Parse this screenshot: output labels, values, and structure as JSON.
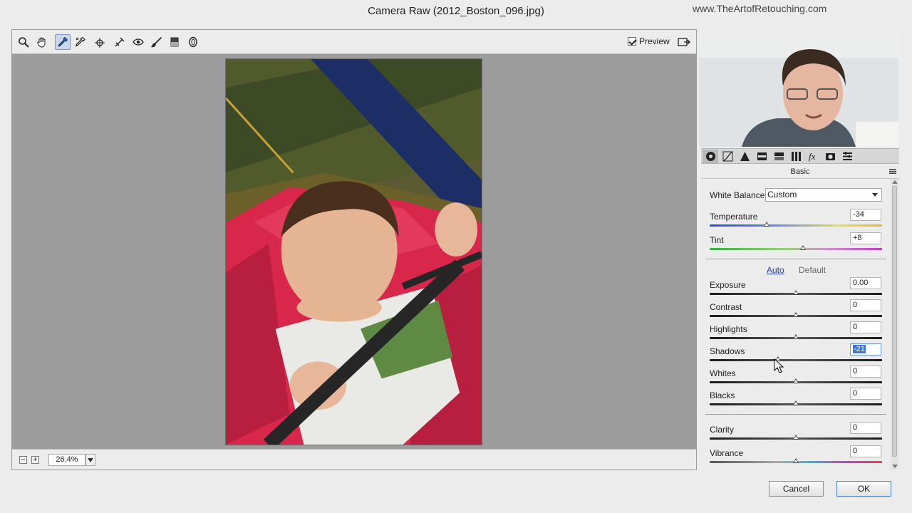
{
  "window": {
    "title": "Camera Raw (2012_Boston_096.jpg)",
    "watermark": "www.TheArtofRetouching.com"
  },
  "toolbar": {
    "tools": [
      {
        "name": "zoom-tool",
        "icon": "zoom-icon",
        "active": false
      },
      {
        "name": "hand-tool",
        "icon": "hand-icon",
        "active": false
      },
      {
        "name": "white-balance-tool",
        "icon": "eyedropper-icon",
        "active": true
      },
      {
        "name": "color-sampler-tool",
        "icon": "color-sampler-icon",
        "active": false
      },
      {
        "name": "targeted-adjustment-tool",
        "icon": "target-adjust-icon",
        "active": false
      },
      {
        "name": "crop-tool",
        "icon": "crop-icon",
        "active": false
      },
      {
        "name": "spot-removal-tool",
        "icon": "spot-removal-icon",
        "active": false
      },
      {
        "name": "red-eye-tool",
        "icon": "red-eye-icon",
        "active": false
      },
      {
        "name": "adjustment-brush-tool",
        "icon": "brush-icon",
        "active": false
      },
      {
        "name": "graduated-filter-tool",
        "icon": "graduated-filter-icon",
        "active": false
      },
      {
        "name": "radial-filter-tool",
        "icon": "radial-filter-icon",
        "active": false
      }
    ],
    "preview_label": "Preview",
    "preview_checked": true
  },
  "status": {
    "zoom": "26.4%"
  },
  "panel": {
    "tabs": [
      "basic-icon",
      "tone-curve-icon",
      "detail-icon",
      "hsl-icon",
      "split-toning-icon",
      "lens-corrections-icon",
      "effects-icon",
      "camera-calibration-icon",
      "presets-icon"
    ],
    "header": "Basic",
    "white_balance": {
      "label": "White Balance:",
      "value": "Custom"
    },
    "temperature": {
      "label": "Temperature",
      "value": "-34",
      "level": -0.34
    },
    "tint": {
      "label": "Tint",
      "value": "+8",
      "level": 0.08
    },
    "auto_label": "Auto",
    "default_label": "Default",
    "exposure": {
      "label": "Exposure",
      "value": "0.00",
      "level": 0
    },
    "contrast": {
      "label": "Contrast",
      "value": "0",
      "level": 0
    },
    "highlights": {
      "label": "Highlights",
      "value": "0",
      "level": 0
    },
    "shadows": {
      "label": "Shadows",
      "value": "-21",
      "level": -0.21
    },
    "whites": {
      "label": "Whites",
      "value": "0",
      "level": 0
    },
    "blacks": {
      "label": "Blacks",
      "value": "0",
      "level": 0
    },
    "clarity": {
      "label": "Clarity",
      "value": "0",
      "level": 0
    },
    "vibrance": {
      "label": "Vibrance",
      "value": "0",
      "level": 0
    }
  },
  "buttons": {
    "cancel": "Cancel",
    "ok": "OK"
  },
  "colors": {
    "accent": "#3a78d6",
    "link": "#2b3fb3"
  }
}
